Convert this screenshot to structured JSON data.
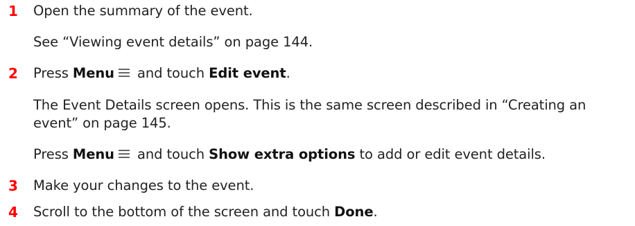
{
  "colors": {
    "step_number": "#ff0000",
    "text": "#222222"
  },
  "icons": {
    "menu": "menu-icon"
  },
  "steps": [
    {
      "number": "1",
      "line1": "Open the summary of the event.",
      "line2": "See “Viewing event details” on page 144."
    },
    {
      "number": "2",
      "pre1": "Press ",
      "menu_label": "Menu",
      "mid1": " and touch ",
      "action1": "Edit event",
      "post1": ".",
      "para_line1": "The Event Details screen opens. This is the same screen described in “Creating an",
      "para_line2": "event” on page 145.",
      "pre2": "Press ",
      "menu_label2": "Menu",
      "mid2": " and touch ",
      "action2": "Show extra options",
      "post2": " to add or edit event details."
    },
    {
      "number": "3",
      "line1": "Make your changes to the event."
    },
    {
      "number": "4",
      "pre": "Scroll to the bottom of the screen and touch ",
      "action": "Done",
      "post": "."
    }
  ]
}
